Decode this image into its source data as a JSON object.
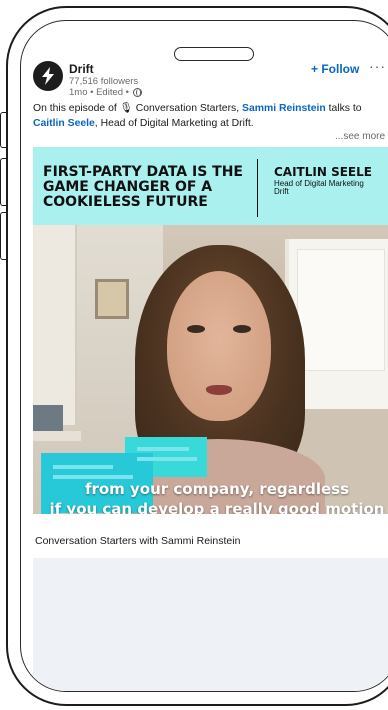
{
  "post": {
    "author": "Drift",
    "followers": "77,516 followers",
    "meta": "1mo • Edited •",
    "follow_label": "+ Follow",
    "more_label": "···",
    "caption_part1": "On this episode of ",
    "caption_emoji": "🎙",
    "caption_part2": " Conversation Starters, ",
    "caption_link1": "Sammi Reinstein",
    "caption_part3": " talks to ",
    "caption_link2": "Caitlin Seele",
    "caption_part4": ", Head of Digital Marketing at Drift.",
    "see_more": "...see more"
  },
  "video": {
    "headline": "FIRST-PARTY DATA IS THE GAME CHANGER OF A COOKIELESS FUTURE",
    "guest_name": "CAITLIN SEELE",
    "guest_role_line1": "Head of Digital Marketing",
    "guest_role_line2": "Drift",
    "subtitle_line1": "from your company, regardless",
    "subtitle_line2": "if you can develop a really good motion",
    "title": "Conversation Starters with Sammi Reinstein"
  },
  "colors": {
    "banner": "#aaf0ee",
    "link": "#0a66c2",
    "bubble": "#27c9d8"
  },
  "icons": {
    "avatar": "drift-logo-icon",
    "visibility": "globe-icon",
    "menu": "more-dots-icon"
  }
}
